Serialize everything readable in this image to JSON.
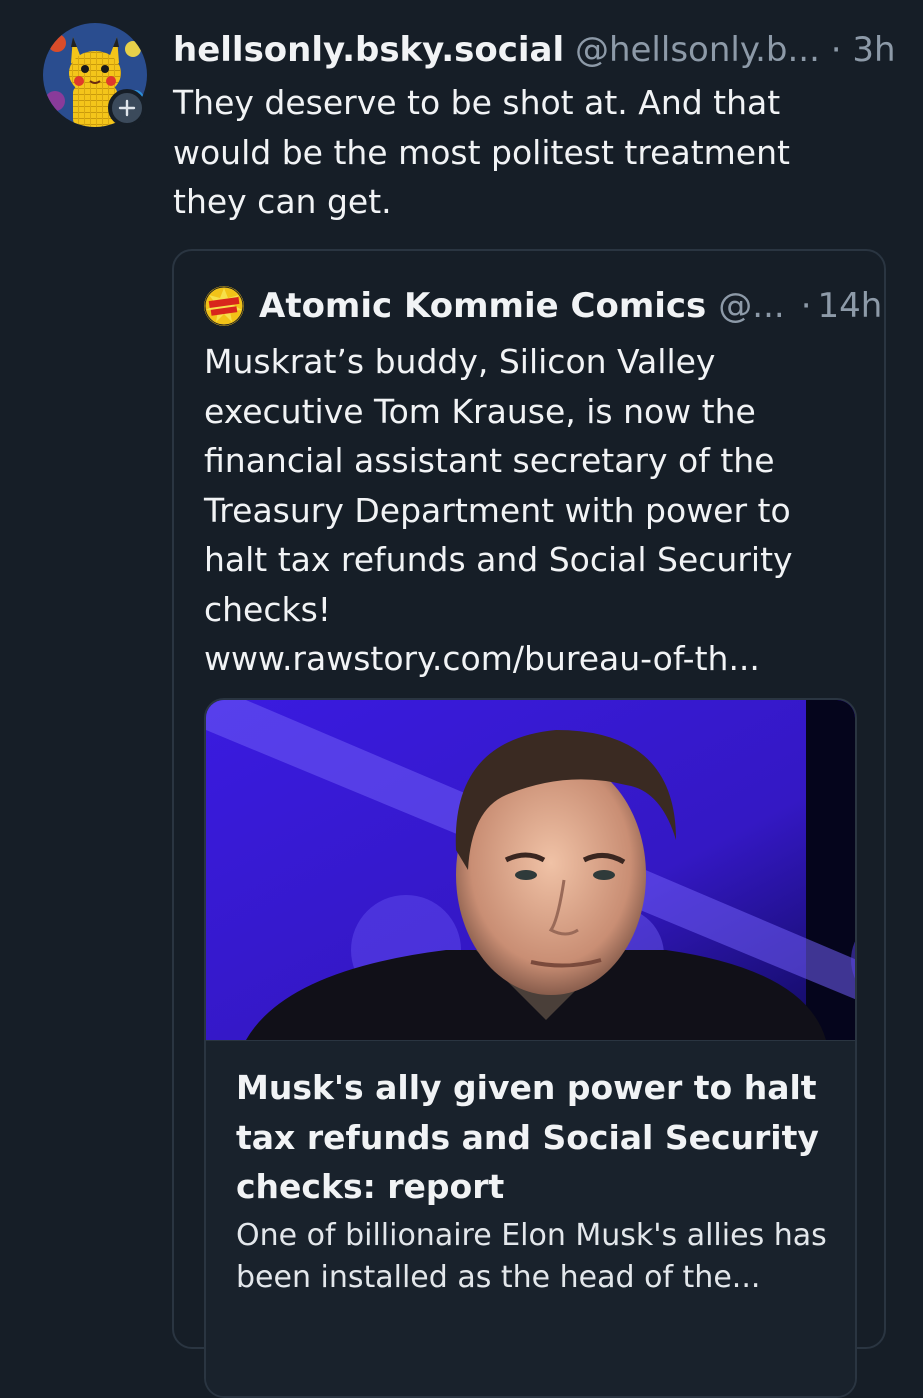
{
  "post": {
    "display_name": "hellsonly.bsky.social",
    "handle": "@hellsonly.b...",
    "separator": "·",
    "time": "3h",
    "text": "They deserve to be shot at. And that would be the most politest treatment they can get.",
    "avatar_icon": "pikachu-lego-avatar",
    "follow_icon": "plus-icon"
  },
  "quote": {
    "display_name": "Atomic Kommie Comics",
    "handle": "@...",
    "separator": "·",
    "time": "14h",
    "text": "Muskrat’s buddy, Silicon Valley executive Tom Krause, is now the financial assistant secretary of the Treasury Department with power to halt tax refunds and Social Security checks!",
    "link_text": "www.rawstory.com/bureau-of-th...",
    "avatar_icon": "atomic-comics-logo",
    "link_card": {
      "title": "Musk's ally given power to halt tax refunds and Social Security checks: report",
      "description": "One of billionaire Elon Musk's allies has been installed as the head of the...",
      "image_icon": "elon-musk-photo"
    }
  },
  "colors": {
    "background": "#161e27",
    "text_primary": "#f1f3f5",
    "text_secondary": "#8d9aa8",
    "border": "#2a3541",
    "thumb_blue": "#3b1fd6"
  }
}
